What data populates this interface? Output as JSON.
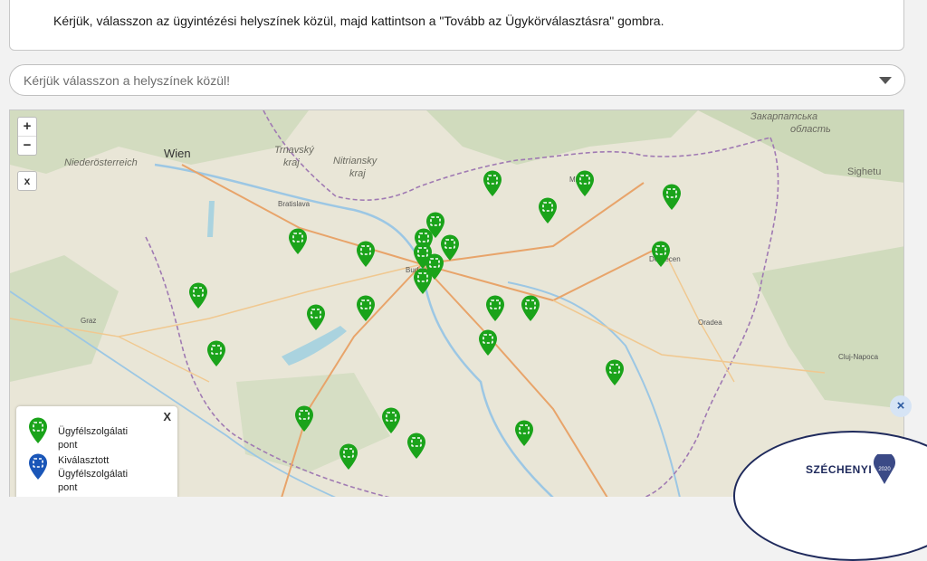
{
  "notice": "Kérjük, válasszon az ügyintézési helyszínek közül, majd kattintson a \"Tovább az Ügykörválasztásra\" gombra.",
  "select_placeholder": "Kérjük válasszon a helyszínek közül!",
  "map": {
    "zoom_in": "+",
    "zoom_out": "−",
    "close_button": "x",
    "labels": [
      {
        "text": "Wien"
      },
      {
        "text": "Niederösterreich"
      },
      {
        "text": "Trnavský"
      },
      {
        "text": "kraj"
      },
      {
        "text": "Nitriansky"
      },
      {
        "text": "kraj"
      },
      {
        "text": "Закарпатська"
      },
      {
        "text": "область"
      },
      {
        "text": "Sighetu"
      },
      {
        "text": "Bratislava"
      },
      {
        "text": "Miskolc"
      },
      {
        "text": "Debrecen"
      },
      {
        "text": "Oradea"
      },
      {
        "text": "Cluj-Napoca"
      },
      {
        "text": "Graz"
      },
      {
        "text": "Budapest"
      }
    ],
    "markers_count": 24,
    "marker_color": "#1aa31a",
    "selected_marker_color": "#1a56b8"
  },
  "legend": {
    "close": "X",
    "item1": "Ügyfélszolgálati pont",
    "item2_line1": "Kiválasztott",
    "item2_line2": "Ügyfélszolgálati pont"
  },
  "badge": {
    "text": "SZÉCHENYI",
    "year": "2020"
  },
  "close_badge": "×"
}
